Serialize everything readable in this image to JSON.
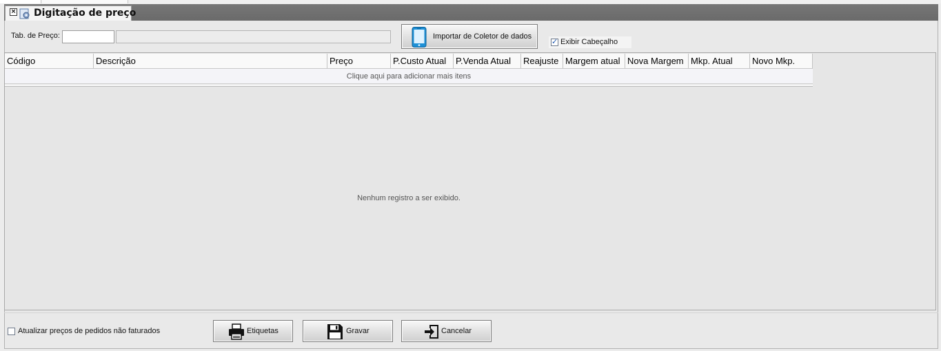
{
  "window": {
    "title": "Digitação de preço"
  },
  "filter": {
    "table_label": "Tab. de Preço:",
    "table_code_value": "",
    "table_desc_value": ""
  },
  "import_button": {
    "label": "Importar de Coletor de dados",
    "icon": "smartphone-icon"
  },
  "show_header": {
    "label": "Exibir Cabeçalho",
    "checked": true
  },
  "grid": {
    "columns": [
      "Código",
      "Descrição",
      "Preço",
      "P.Custo Atual",
      "P.Venda Atual",
      "Reajuste",
      "Margem atual",
      "Nova Margem",
      "Mkp. Atual",
      "Novo Mkp."
    ],
    "add_row_text": "Clique aqui para adicionar mais itens",
    "empty_text": "Nenhum registro a ser exibido."
  },
  "footer": {
    "update_orders_label": "Atualizar preços de pedidos não faturados",
    "update_orders_checked": false,
    "buttons": {
      "labels": "Etiquetas",
      "save": "Gravar",
      "cancel": "Cancelar"
    }
  },
  "colors": {
    "title_bar": "#6f6f6f",
    "accent_blue": "#1e90d6",
    "background": "#e9e9e9"
  }
}
